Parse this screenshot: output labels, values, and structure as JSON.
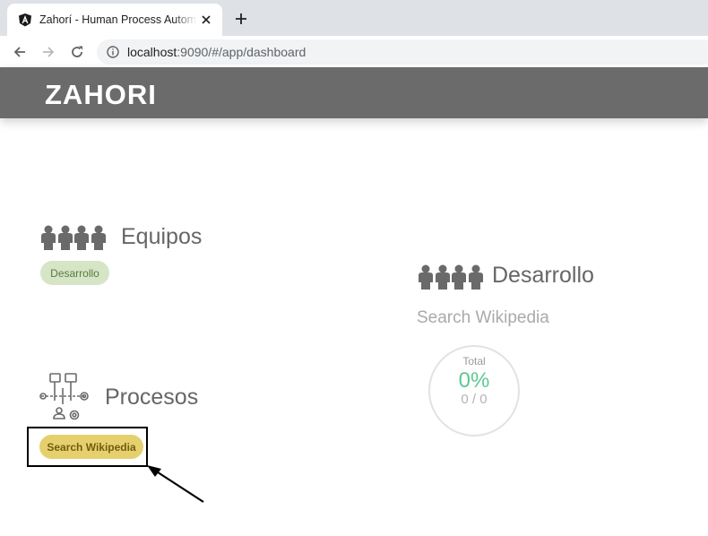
{
  "browser": {
    "tab_title": "Zahorí - Human Process Automation",
    "url_host": "localhost",
    "url_rest": ":9090/#/app/dashboard",
    "icons": [
      "angular-icon",
      "close-icon",
      "new-tab-icon",
      "back-icon",
      "forward-icon",
      "reload-icon",
      "info-icon"
    ]
  },
  "header": {
    "logo_text": "ZAHORI",
    "background": "#6b6b6b"
  },
  "teams": {
    "title": "Equipos",
    "items": [
      {
        "label": "Desarrollo"
      }
    ]
  },
  "processes": {
    "title": "Procesos",
    "items": [
      {
        "label": "Search Wikipedia"
      }
    ]
  },
  "team_detail": {
    "title": "Desarrollo",
    "process_name": "Search Wikipedia",
    "stats": {
      "label": "Total",
      "percent": "0%",
      "count": "0 / 0"
    }
  },
  "colors": {
    "chip_green": "#d5e5c6",
    "chip_yellow": "#e6d06e",
    "percent_green": "#5ec892"
  }
}
